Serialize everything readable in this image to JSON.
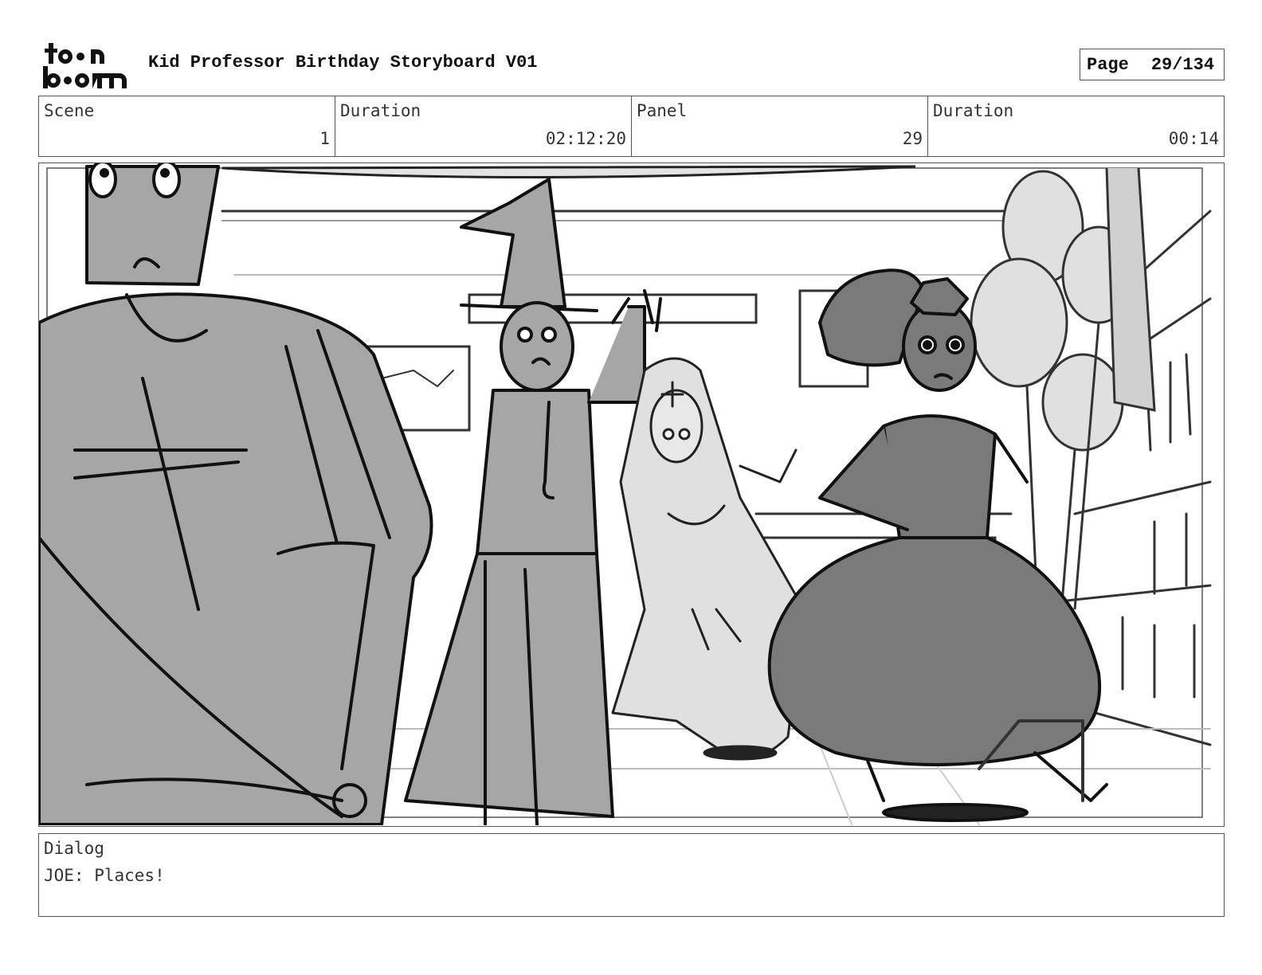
{
  "header": {
    "logo_text_top": "toon",
    "logo_text_bottom": "boom",
    "title": "Kid Professor Birthday Storyboard V01",
    "page_label": "Page",
    "page_value": "29/134"
  },
  "info": [
    {
      "label": "Scene",
      "value": "1"
    },
    {
      "label": "Duration",
      "value": "02:12:20"
    },
    {
      "label": "Panel",
      "value": "29"
    },
    {
      "label": "Duration",
      "value": "00:14"
    }
  ],
  "dialog": {
    "label": "Dialog",
    "text": "JOE: Places!"
  },
  "colors": {
    "border": "#555555",
    "sketch_dark": "#111111",
    "fill_mid": "#a6a6a6",
    "fill_dark": "#7a7a7a",
    "fill_light": "#e0e0e0"
  }
}
